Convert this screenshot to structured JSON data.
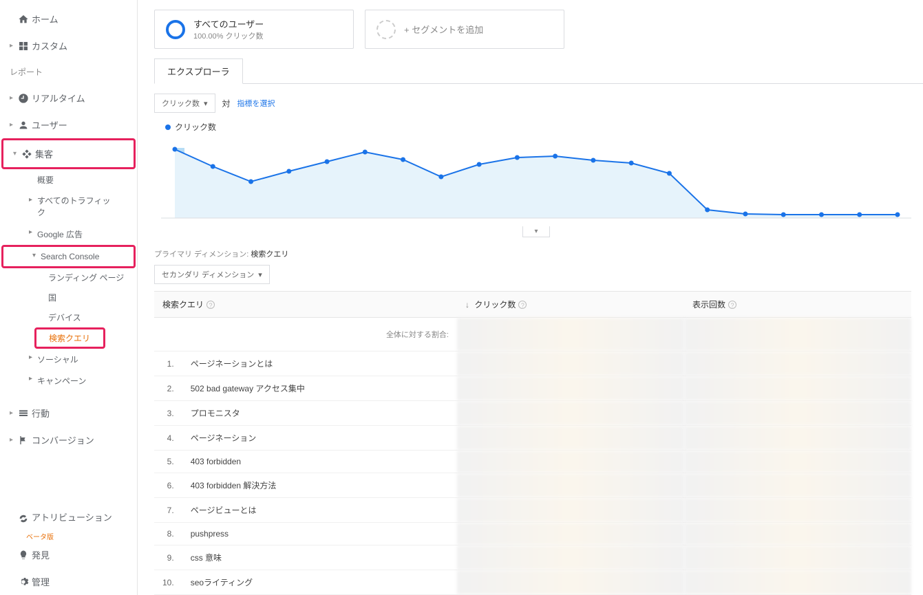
{
  "sidebar": {
    "home": "ホーム",
    "custom": "カスタム",
    "report_label": "レポート",
    "realtime": "リアルタイム",
    "user": "ユーザー",
    "acquisition": "集客",
    "acq_children": {
      "overview": "概要",
      "all_traffic": "すべてのトラフィック",
      "google_ads": "Google 広告",
      "search_console": "Search Console",
      "sc_children": {
        "landing": "ランディング ページ",
        "country": "国",
        "device": "デバイス",
        "query": "検索クエリ"
      },
      "social": "ソーシャル",
      "campaign": "キャンペーン"
    },
    "behavior": "行動",
    "conversion": "コンバージョン",
    "attribution": "アトリビューション",
    "beta": "ベータ版",
    "discover": "発見",
    "admin": "管理"
  },
  "segments": {
    "all_users_title": "すべてのユーザー",
    "all_users_sub": "100.00% クリック数",
    "add_segment": "+ セグメントを追加"
  },
  "tabs": {
    "explorer": "エクスプローラ"
  },
  "graph": {
    "metric_dropdown": "クリック数",
    "vs": "対",
    "select_metric": "指標を選択",
    "legend": "クリック数"
  },
  "dimension_label_prefix": "プライマリ ディメンション:",
  "dimension_value": "検索クエリ",
  "secondary_dim": "セカンダリ ディメンション",
  "table": {
    "columns": {
      "query": "検索クエリ",
      "clicks": "クリック数",
      "impressions": "表示回数"
    },
    "ratio_label": "全体に対する割合:",
    "rows": [
      {
        "n": "1.",
        "q": "ページネーションとは"
      },
      {
        "n": "2.",
        "q": "502 bad gateway アクセス集中"
      },
      {
        "n": "3.",
        "q": "プロモニスタ"
      },
      {
        "n": "4.",
        "q": "ページネーション"
      },
      {
        "n": "5.",
        "q": "403 forbidden"
      },
      {
        "n": "6.",
        "q": "403 forbidden 解決方法"
      },
      {
        "n": "7.",
        "q": "ページビューとは"
      },
      {
        "n": "8.",
        "q": "pushpress"
      },
      {
        "n": "9.",
        "q": "css 意味"
      },
      {
        "n": "10.",
        "q": "seoライティング"
      }
    ]
  },
  "chart_data": {
    "type": "line",
    "title": "クリック数",
    "series_name": "クリック数",
    "x_count": 20,
    "values": [
      100,
      75,
      53,
      68,
      82,
      96,
      85,
      60,
      78,
      88,
      90,
      84,
      80,
      65,
      12,
      6,
      5,
      5,
      5,
      5
    ],
    "ylim": [
      0,
      110
    ]
  }
}
